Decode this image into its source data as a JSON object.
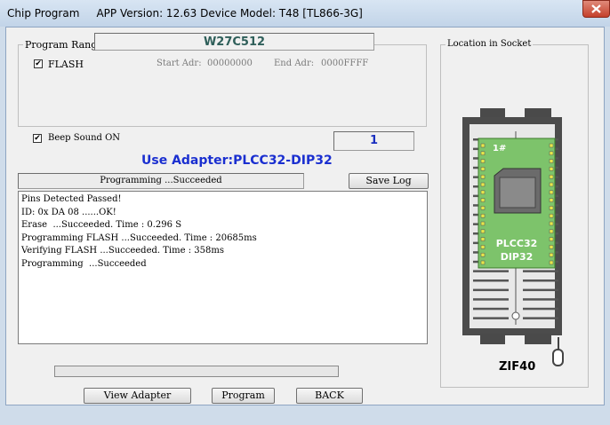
{
  "window": {
    "title": "Chip Program     APP Version: 12.63 Device Model: T48 [TL866-3G]",
    "close_icon": "close-icon"
  },
  "program_range": {
    "legend": "Program Range",
    "chip_name": "W27C512",
    "flash_checked": true,
    "flash_label": "FLASH",
    "start_label": "Start Adr:",
    "start_value": "00000000",
    "end_label": "End Adr:",
    "end_value": "0000FFFF"
  },
  "beep": {
    "checked": true,
    "label": "Beep Sound ON"
  },
  "counter": "1",
  "adapter_text": "Use Adapter:PLCC32-DIP32",
  "status": "Programming  ...Succeeded",
  "save_log_label": "Save Log",
  "log_lines": [
    "Pins Detected Passed!",
    "ID: 0x DA 08 ......OK!",
    "Erase  ...Succeeded. Time : 0.296 S",
    "Programming FLASH ...Succeeded. Time : 20685ms",
    "Verifying FLASH ...Succeeded. Time : 358ms",
    "Programming  ...Succeeded"
  ],
  "progress_fraction": 0,
  "buttons": {
    "view_adapter": "View Adapter",
    "program": "Program",
    "back": "BACK"
  },
  "socket": {
    "legend": "Location in Socket",
    "pin1_label": "1#",
    "chip_text": [
      "PLCC32",
      "DIP32"
    ],
    "zif_label": "ZIF40",
    "chip_color": "#7dc36b"
  }
}
